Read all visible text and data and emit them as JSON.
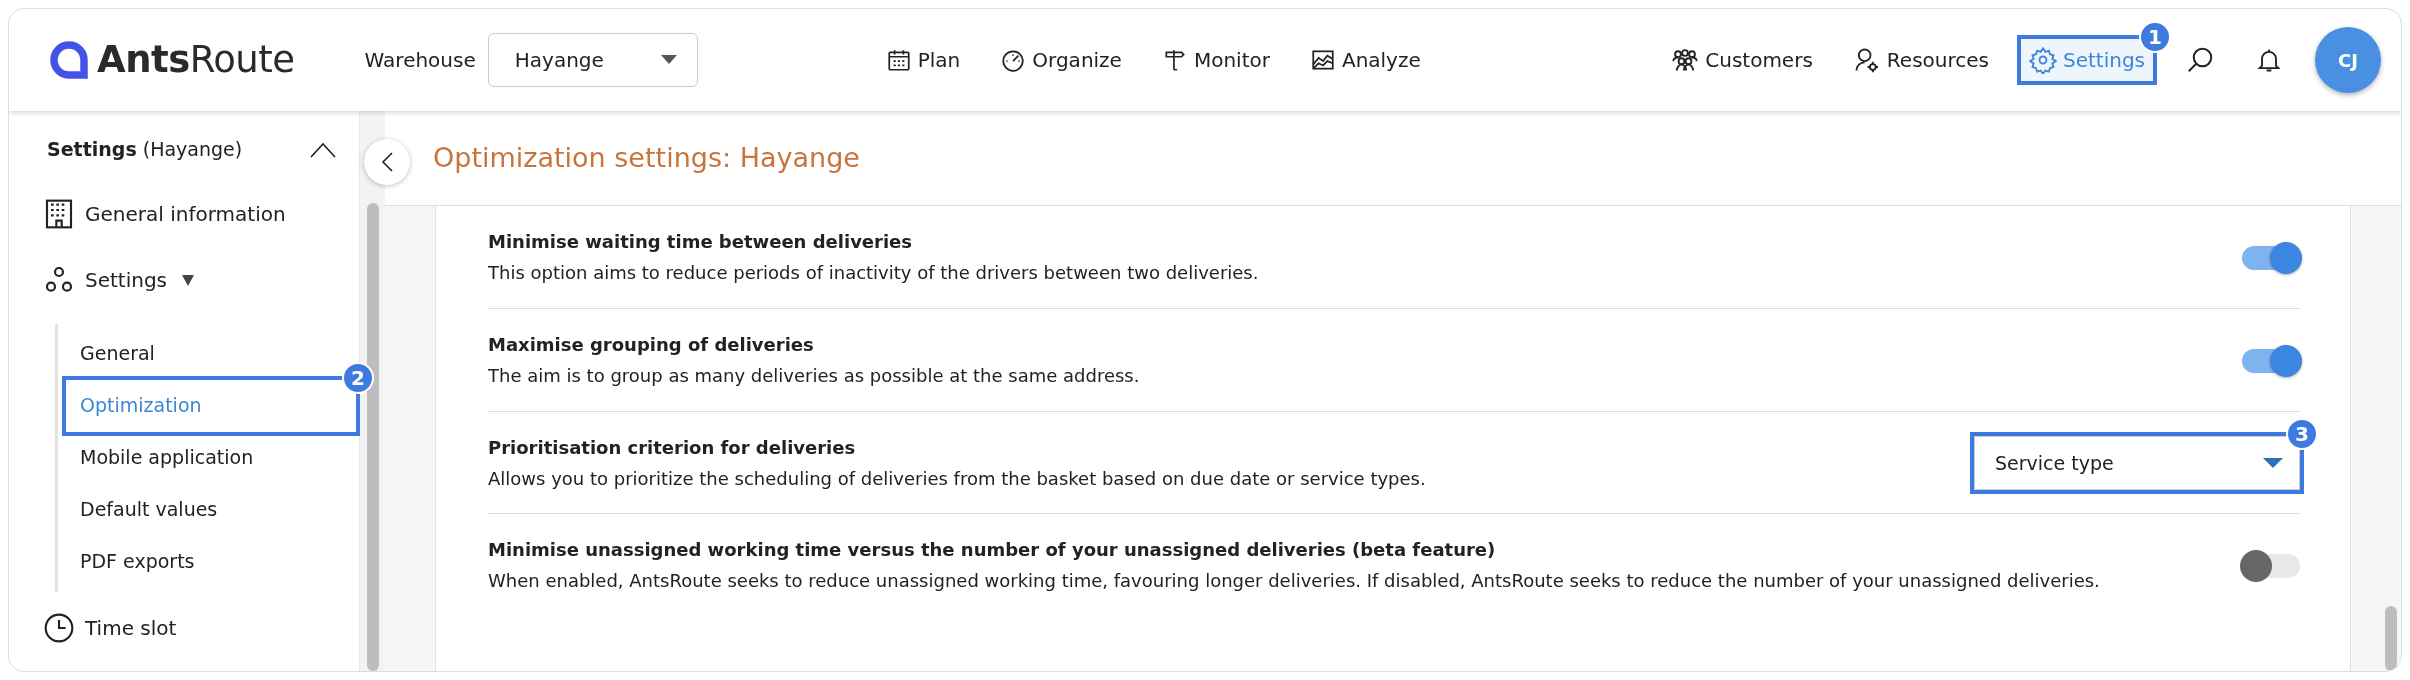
{
  "header": {
    "logo": "**Ants**Route",
    "warehouse_label": "Warehouse",
    "warehouse_value": "Hayange",
    "nav": [
      {
        "label": "Plan",
        "selected": false
      },
      {
        "label": "Organize",
        "selected": false
      },
      {
        "label": "Monitor",
        "selected": false
      },
      {
        "label": "Analyze",
        "selected": false
      }
    ],
    "right_nav": [
      {
        "label": "Customers",
        "selected": false
      },
      {
        "label": "Resources",
        "selected": false
      },
      {
        "label": "Settings",
        "selected": true,
        "callout": "1"
      }
    ],
    "avatar": "CJ"
  },
  "sidebar": {
    "title": "**Settings** (Hayange)",
    "items": [
      {
        "label": "General information"
      },
      {
        "label": "Settings",
        "expanded": true,
        "children": [
          {
            "label": "General",
            "selected": false
          },
          {
            "label": "Optimization",
            "selected": true,
            "callout": "2"
          },
          {
            "label": "Mobile application",
            "selected": false
          },
          {
            "label": "Default values",
            "selected": false
          },
          {
            "label": "PDF exports",
            "selected": false
          }
        ]
      },
      {
        "label": "Time slot"
      }
    ]
  },
  "main": {
    "title": "Optimization settings: Hayange",
    "options": [
      {
        "kind": "toggle",
        "title": "Minimise waiting time between deliveries",
        "description": "This option aims to reduce periods of inactivity of the drivers between two deliveries.",
        "on": true
      },
      {
        "kind": "toggle",
        "title": "Maximise grouping of deliveries",
        "description": "The aim is to group as many deliveries as possible at the same address.",
        "on": true
      },
      {
        "kind": "select",
        "title": "Prioritisation criterion for deliveries",
        "description": "Allows you to prioritize the scheduling of deliveries from the basket based on due date or service types.",
        "value": "Service type",
        "callout": "3"
      },
      {
        "kind": "toggle",
        "title": "Minimise unassigned working time versus the number of your unassigned deliveries (beta feature)",
        "description": "When enabled, AntsRoute seeks to reduce unassigned working time, favouring longer deliveries. If disabled, AntsRoute seeks to reduce the number of your unassigned deliveries.",
        "on": false
      }
    ]
  }
}
